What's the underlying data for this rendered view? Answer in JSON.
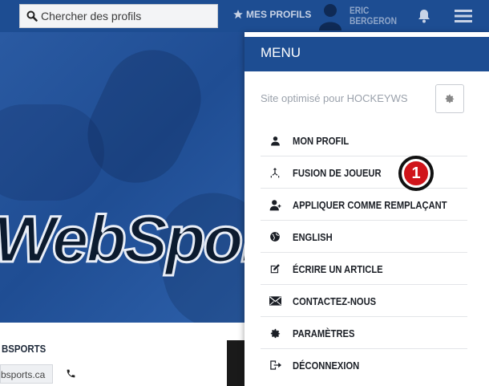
{
  "topbar": {
    "search_placeholder": "Chercher des profils",
    "favorites_label": "MES PROFILS",
    "user_name_line1": "ERIC",
    "user_name_line2": "BERGERON"
  },
  "hero": {
    "logo_text": "WebSports",
    "section_title": "BSPORTS",
    "site_link": "bsports.ca"
  },
  "menu": {
    "title": "MENU",
    "optimized_text": "Site optimisé pour HOCKEYWS",
    "items": [
      {
        "label": "MON PROFIL",
        "icon": "user-icon"
      },
      {
        "label": "FUSION DE JOUEUR",
        "icon": "merge-icon"
      },
      {
        "label": "APPLIQUER COMME REMPLAÇANT",
        "icon": "user-plus-icon"
      },
      {
        "label": "ENGLISH",
        "icon": "globe-icon"
      },
      {
        "label": "ÉCRIRE UN ARTICLE",
        "icon": "edit-icon"
      },
      {
        "label": "CONTACTEZ-NOUS",
        "icon": "envelope-icon"
      },
      {
        "label": "PARAMÈTRES",
        "icon": "gear-icon"
      },
      {
        "label": "DÉCONNEXION",
        "icon": "logout-icon"
      }
    ]
  },
  "callout": {
    "number": "1"
  },
  "colors": {
    "topbar": "#1d4d92",
    "menu_header": "#1d4d92",
    "badge": "#d0141a"
  }
}
